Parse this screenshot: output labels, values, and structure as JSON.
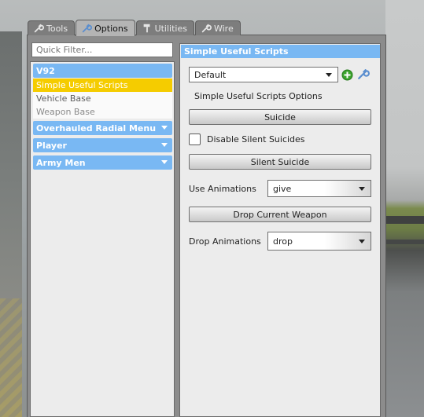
{
  "tabs": [
    {
      "label": "Tools",
      "icon": "wrench-icon"
    },
    {
      "label": "Options",
      "icon": "wrench-icon",
      "active": true
    },
    {
      "label": "Utilities",
      "icon": "hammer-icon"
    },
    {
      "label": "Wire",
      "icon": "wrench-icon"
    }
  ],
  "sidebar": {
    "filter_placeholder": "Quick Filter...",
    "categories": [
      {
        "title": "V92",
        "items": [
          "Simple Useful Scripts",
          "Vehicle Base",
          "Weapon Base"
        ],
        "selected": "Simple Useful Scripts"
      },
      {
        "title": "Overhauled Radial Menu"
      },
      {
        "title": "Player"
      },
      {
        "title": "Army Men"
      }
    ]
  },
  "panel": {
    "title": "Simple Useful Scripts",
    "preset_value": "Default",
    "options_label": "Simple Useful Scripts Options",
    "suicide_button": "Suicide",
    "disable_silent_label": "Disable Silent Suicides",
    "disable_silent_checked": false,
    "silent_suicide_button": "Silent Suicide",
    "use_animations_label": "Use Animations",
    "use_animations_value": "give",
    "drop_weapon_button": "Drop Current Weapon",
    "drop_animations_label": "Drop Animations",
    "drop_animations_value": "drop"
  },
  "colors": {
    "header_blue": "#79b8f3",
    "selected_yellow": "#f5cc00",
    "add_green": "#3ba32c"
  }
}
